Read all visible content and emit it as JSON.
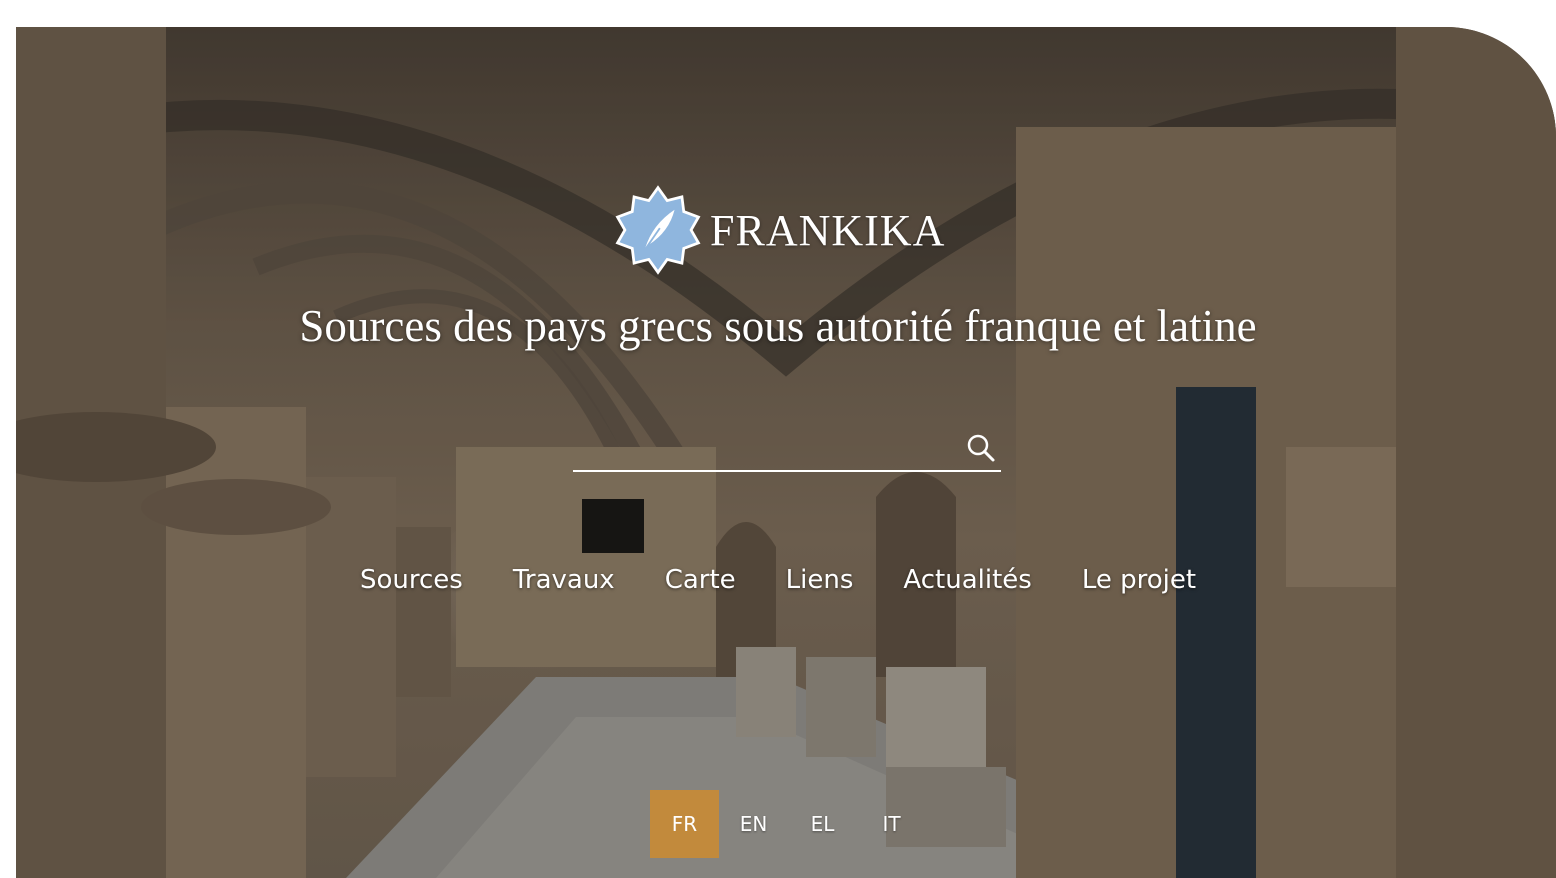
{
  "brand": {
    "name": "FRANKIKA",
    "logo_icon": "quill-feather-icon"
  },
  "tagline": "Sources des pays grecs sous autorité franque et latine",
  "search": {
    "value": "",
    "placeholder": "",
    "icon": "search-icon"
  },
  "nav": {
    "items": [
      {
        "label": "Sources"
      },
      {
        "label": "Travaux"
      },
      {
        "label": "Carte"
      },
      {
        "label": "Liens"
      },
      {
        "label": "Actualités"
      },
      {
        "label": "Le projet"
      }
    ]
  },
  "languages": {
    "items": [
      {
        "label": "FR"
      },
      {
        "label": "EN"
      },
      {
        "label": "EL"
      },
      {
        "label": "IT"
      }
    ],
    "active": "FR"
  },
  "colors": {
    "accent": "#c28a3c",
    "logo_blue": "#8fb6de",
    "text": "#ffffff",
    "corner_accent": "#c87a3a"
  }
}
